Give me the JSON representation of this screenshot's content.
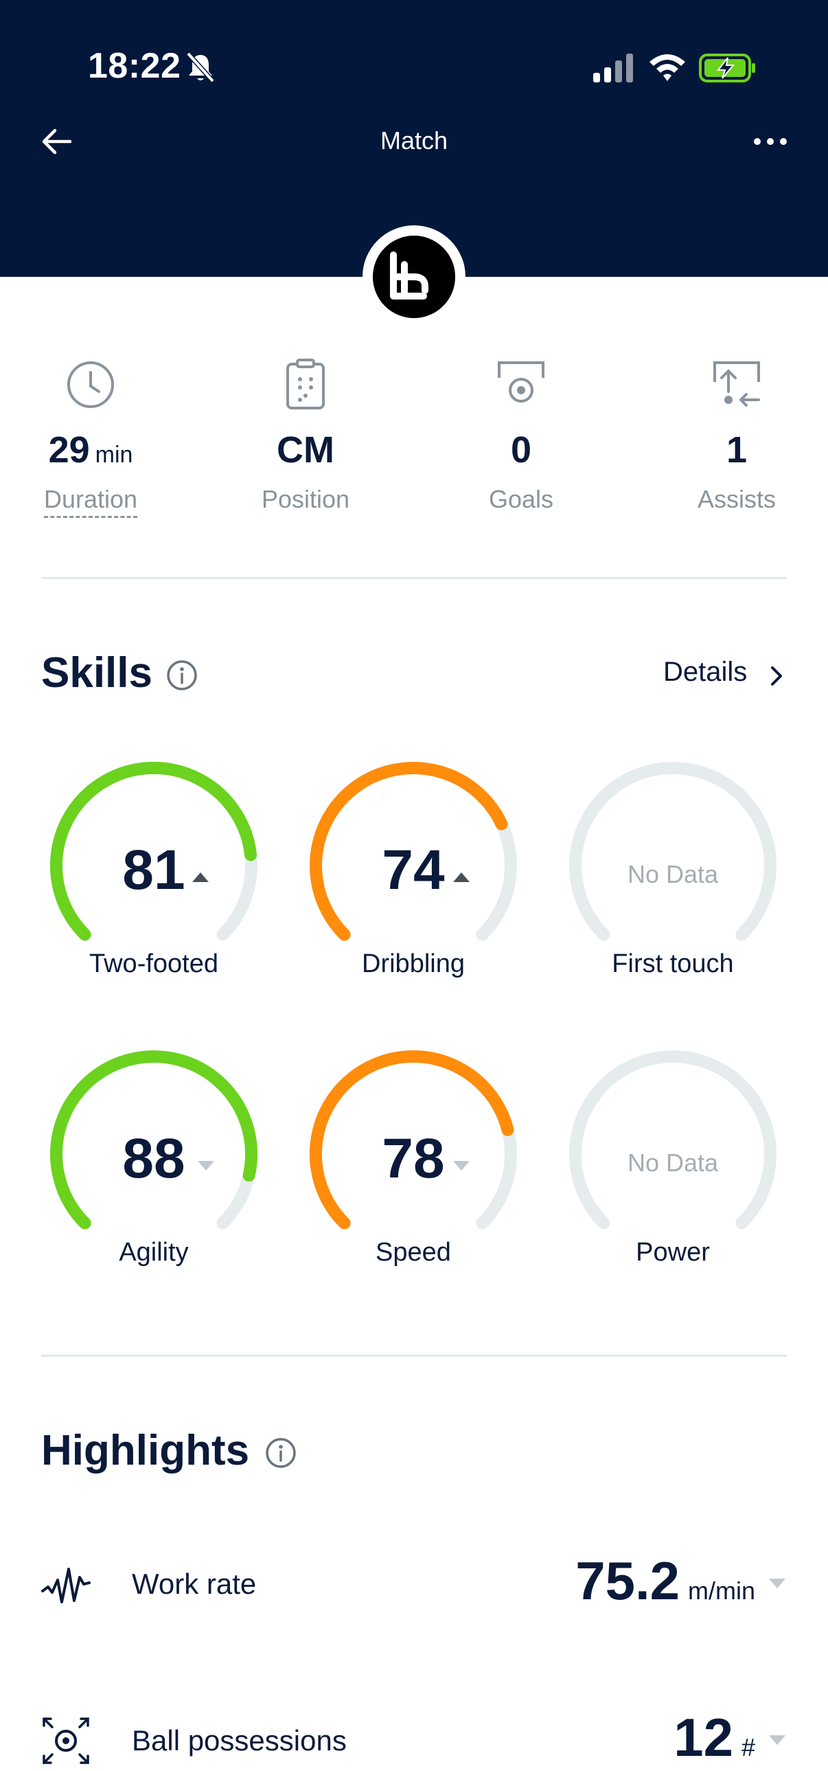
{
  "status_bar": {
    "time": "18:22"
  },
  "header": {
    "title": "Match"
  },
  "stats": [
    {
      "value": "29",
      "unit": "min",
      "label": "Duration",
      "icon": "clock-icon"
    },
    {
      "value": "CM",
      "unit": "",
      "label": "Position",
      "icon": "clipboard-icon"
    },
    {
      "value": "0",
      "unit": "",
      "label": "Goals",
      "icon": "goal-icon"
    },
    {
      "value": "1",
      "unit": "",
      "label": "Assists",
      "icon": "assist-icon"
    }
  ],
  "skills": {
    "title": "Skills",
    "details_label": "Details",
    "no_data_text": "No Data",
    "items": [
      {
        "label": "Two-footed",
        "value": "81",
        "progress": 0.81,
        "trend": "up",
        "color": "#6bd21e"
      },
      {
        "label": "Dribbling",
        "value": "74",
        "progress": 0.74,
        "trend": "up",
        "color": "#ff8c0a"
      },
      {
        "label": "First touch",
        "value": null,
        "progress": 0,
        "trend": "none",
        "color": "#e6ecee"
      },
      {
        "label": "Agility",
        "value": "88",
        "progress": 0.88,
        "trend": "down",
        "color": "#6bd21e"
      },
      {
        "label": "Speed",
        "value": "78",
        "progress": 0.78,
        "trend": "down",
        "color": "#ff8c0a"
      },
      {
        "label": "Power",
        "value": null,
        "progress": 0,
        "trend": "none",
        "color": "#e6ecee"
      }
    ]
  },
  "highlights": {
    "title": "Highlights",
    "items": [
      {
        "label": "Work rate",
        "value": "75.2",
        "unit": "m/min",
        "icon": "work-rate-icon"
      },
      {
        "label": "Ball possessions",
        "value": "12",
        "unit": "#",
        "icon": "ball-possession-icon"
      }
    ]
  },
  "colors": {
    "header_bg": "#02173a",
    "text": "#0b1a3a",
    "muted": "#8a939c",
    "track": "#e6ecee"
  }
}
